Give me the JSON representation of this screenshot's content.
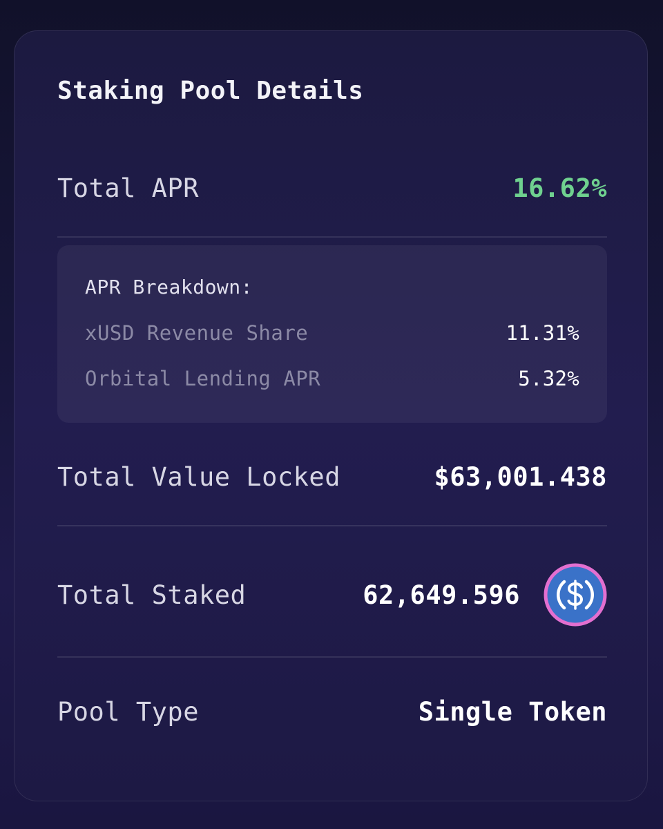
{
  "card": {
    "title": "Staking Pool Details"
  },
  "total_apr": {
    "label": "Total APR",
    "value": "16.62%",
    "value_color": "#6fd18f"
  },
  "apr_breakdown": {
    "title": "APR Breakdown:",
    "items": [
      {
        "label": "xUSD Revenue Share",
        "value": "11.31%"
      },
      {
        "label": "Orbital Lending APR",
        "value": "5.32%"
      }
    ]
  },
  "tvl": {
    "label": "Total Value Locked",
    "value": "$63,001.438"
  },
  "total_staked": {
    "label": "Total Staked",
    "value": "62,649.596",
    "token_icon": "usdc-dollar-icon"
  },
  "pool_type": {
    "label": "Pool Type",
    "value": "Single Token"
  },
  "colors": {
    "accent_green": "#6fd18f",
    "token_blue": "#3a72c8",
    "token_ring_pink": "#e36fd0"
  }
}
